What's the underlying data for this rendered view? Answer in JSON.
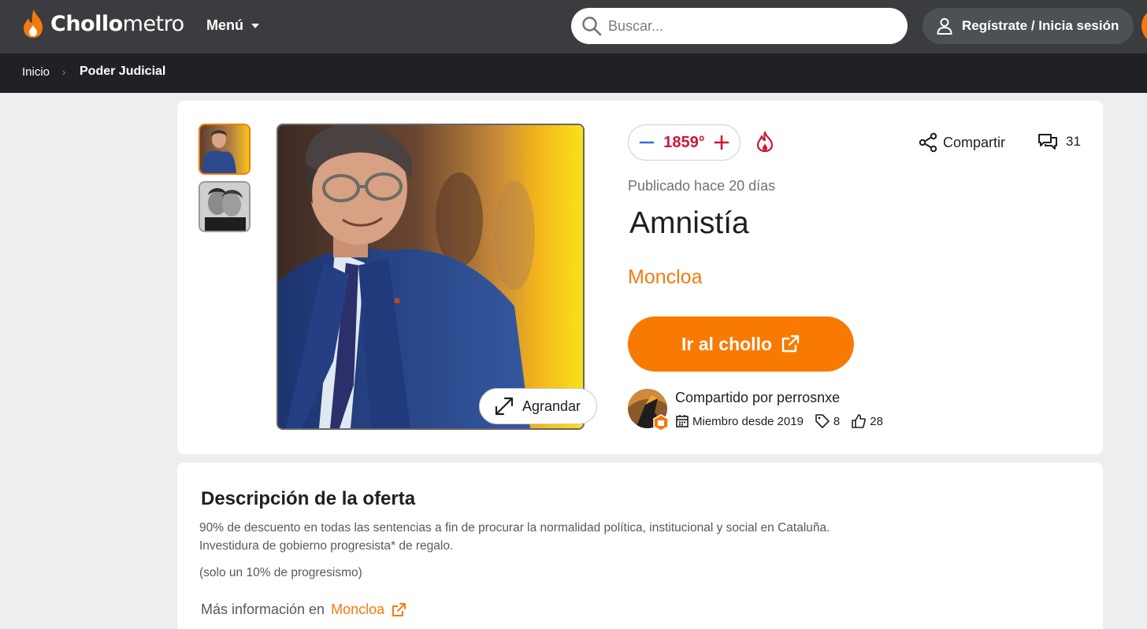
{
  "header": {
    "logo_bold": "Chollo",
    "logo_light": "metro",
    "menu_label": "Menú",
    "search_placeholder": "Buscar...",
    "login_label": "Regístrate / Inicia sesión"
  },
  "breadcrumb": {
    "home": "Inicio",
    "separator": "›",
    "current": "Poder Judicial"
  },
  "deal": {
    "temperature": "1859°",
    "share_label": "Compartir",
    "comment_count": "31",
    "published": "Publicado hace 20 días",
    "title": "Amnistía",
    "merchant": "Moncloa",
    "cta_label": "Ir al chollo",
    "zoom_label": "Agrandar",
    "shared_by": "Compartido por perrosnxe",
    "member_since": "Miembro desde 2019",
    "deals_count": "8",
    "likes_count": "28"
  },
  "description": {
    "heading": "Descripción de la oferta",
    "line1": "90% de descuento en todas las sentencias a fin de procurar la normalidad política, institucional y social en Cataluña.",
    "line2": "Investidura de gobierno progresista* de regalo.",
    "line3": "(solo un 10% de progresismo)",
    "more_info_prefix": "Más información en",
    "more_info_link": "Moncloa"
  },
  "colors": {
    "brand_orange": "#f37b0e",
    "hot_red": "#ce1734",
    "topbar": "#3a3c3f",
    "crumbbar": "#1f2124"
  },
  "icons": [
    "flame-logo-icon",
    "search-icon",
    "user-icon",
    "minus-icon",
    "plus-icon",
    "hot-flame-icon",
    "share-icon",
    "comment-icon",
    "external-link-icon",
    "expand-icon",
    "calendar-icon",
    "tag-icon",
    "thumbs-up-icon"
  ]
}
